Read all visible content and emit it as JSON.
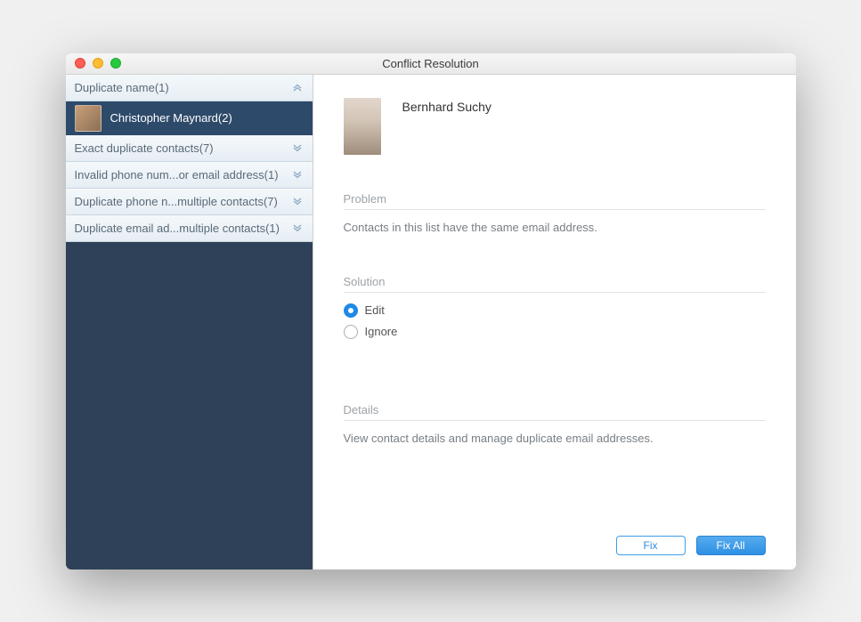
{
  "window": {
    "title": "Conflict Resolution"
  },
  "sidebar": {
    "categories": [
      {
        "label": "Duplicate name(1)",
        "state": "expanded"
      },
      {
        "label": "Exact duplicate contacts(7)",
        "state": "collapsed"
      },
      {
        "label": "Invalid phone num...or email address(1)",
        "state": "collapsed"
      },
      {
        "label": "Duplicate phone n...multiple contacts(7)",
        "state": "collapsed"
      },
      {
        "label": "Duplicate email ad...multiple contacts(1)",
        "state": "collapsed"
      }
    ],
    "selected_item": {
      "name": "Christopher Maynard(2)"
    }
  },
  "detail": {
    "contact_name": "Bernhard Suchy",
    "problem_label": "Problem",
    "problem_text": "Contacts in this list have the same email address.",
    "solution_label": "Solution",
    "solution_options": {
      "edit": "Edit",
      "ignore": "Ignore",
      "selected": "edit"
    },
    "details_label": "Details",
    "details_text": "View contact details and manage duplicate email addresses."
  },
  "buttons": {
    "fix": "Fix",
    "fix_all": "Fix All"
  }
}
